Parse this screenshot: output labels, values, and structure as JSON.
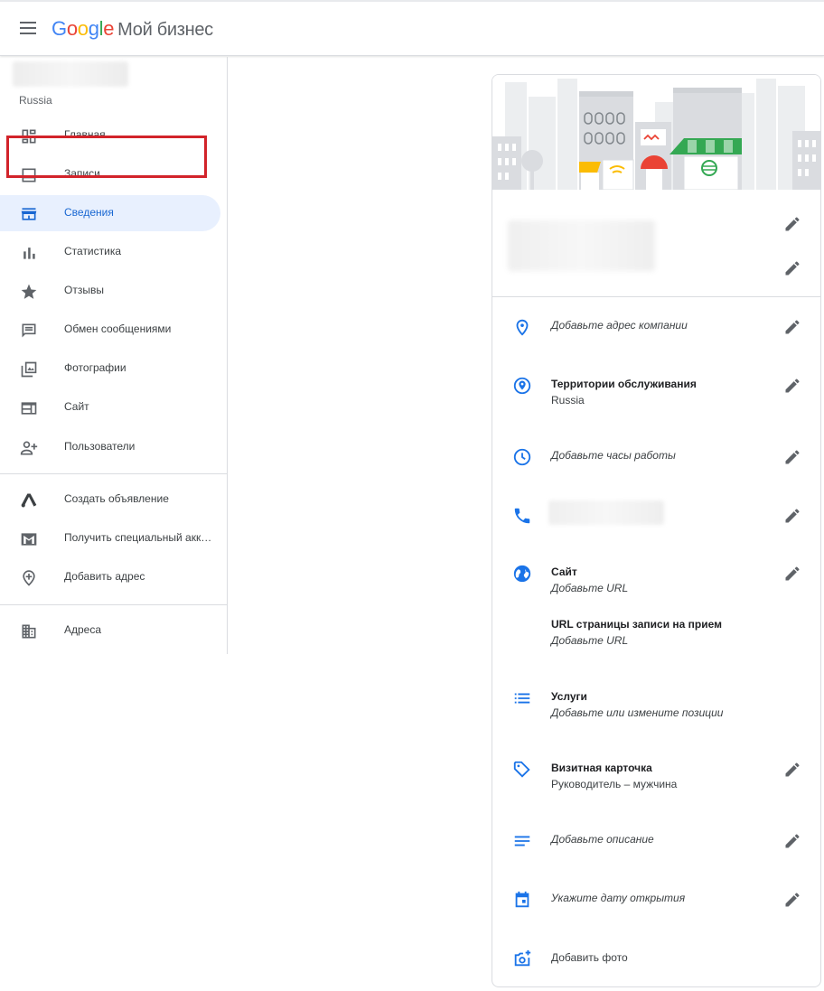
{
  "app": {
    "logo_text": "Google",
    "product_name": "Мой бизнес",
    "brand_colors": [
      "#4285F4",
      "#EA4335",
      "#FBBC05",
      "#34A853"
    ]
  },
  "sidebar": {
    "account_country": "Russia",
    "items": [
      {
        "label": "Главная",
        "icon": "dashboard-icon"
      },
      {
        "label": "Записи",
        "icon": "posts-icon"
      },
      {
        "label": "Сведения",
        "icon": "storefront-icon",
        "active": true
      },
      {
        "label": "Статистика",
        "icon": "bar-chart-icon"
      },
      {
        "label": "Отзывы",
        "icon": "star-icon"
      },
      {
        "label": "Обмен сообщениями",
        "icon": "message-icon"
      },
      {
        "label": "Фотографии",
        "icon": "photo-library-icon"
      },
      {
        "label": "Сайт",
        "icon": "web-icon"
      },
      {
        "label": "Пользователи",
        "icon": "person-add-icon"
      }
    ],
    "secondary_items": [
      {
        "label": "Создать объявление",
        "icon": "google-ads-icon"
      },
      {
        "label": "Получить специальный акк…",
        "icon": "mail-icon"
      },
      {
        "label": "Добавить адрес",
        "icon": "add-location-icon"
      }
    ],
    "tertiary_items": [
      {
        "label": "Адреса",
        "icon": "business-building-icon"
      }
    ],
    "highlight_color": "#d2232a",
    "active_color": "#1967d2"
  },
  "info": {
    "address": {
      "text": "Добавьте адрес компании"
    },
    "service_area": {
      "title": "Территории обслуживания",
      "value": "Russia"
    },
    "hours": {
      "text": "Добавьте часы работы"
    },
    "website": {
      "title": "Сайт",
      "value": "Добавьте URL"
    },
    "booking": {
      "title": "URL страницы записи на прием",
      "value": "Добавьте URL"
    },
    "services": {
      "title": "Услуги",
      "value": "Добавьте или измените позиции"
    },
    "attributes": {
      "title": "Визитная карточка",
      "value": "Руководитель – мужчина"
    },
    "description": {
      "text": "Добавьте описание"
    },
    "opening_date": {
      "text": "Укажите дату открытия"
    },
    "add_photo": {
      "text": "Добавить фото"
    },
    "accent_color": "#1a73e8"
  }
}
